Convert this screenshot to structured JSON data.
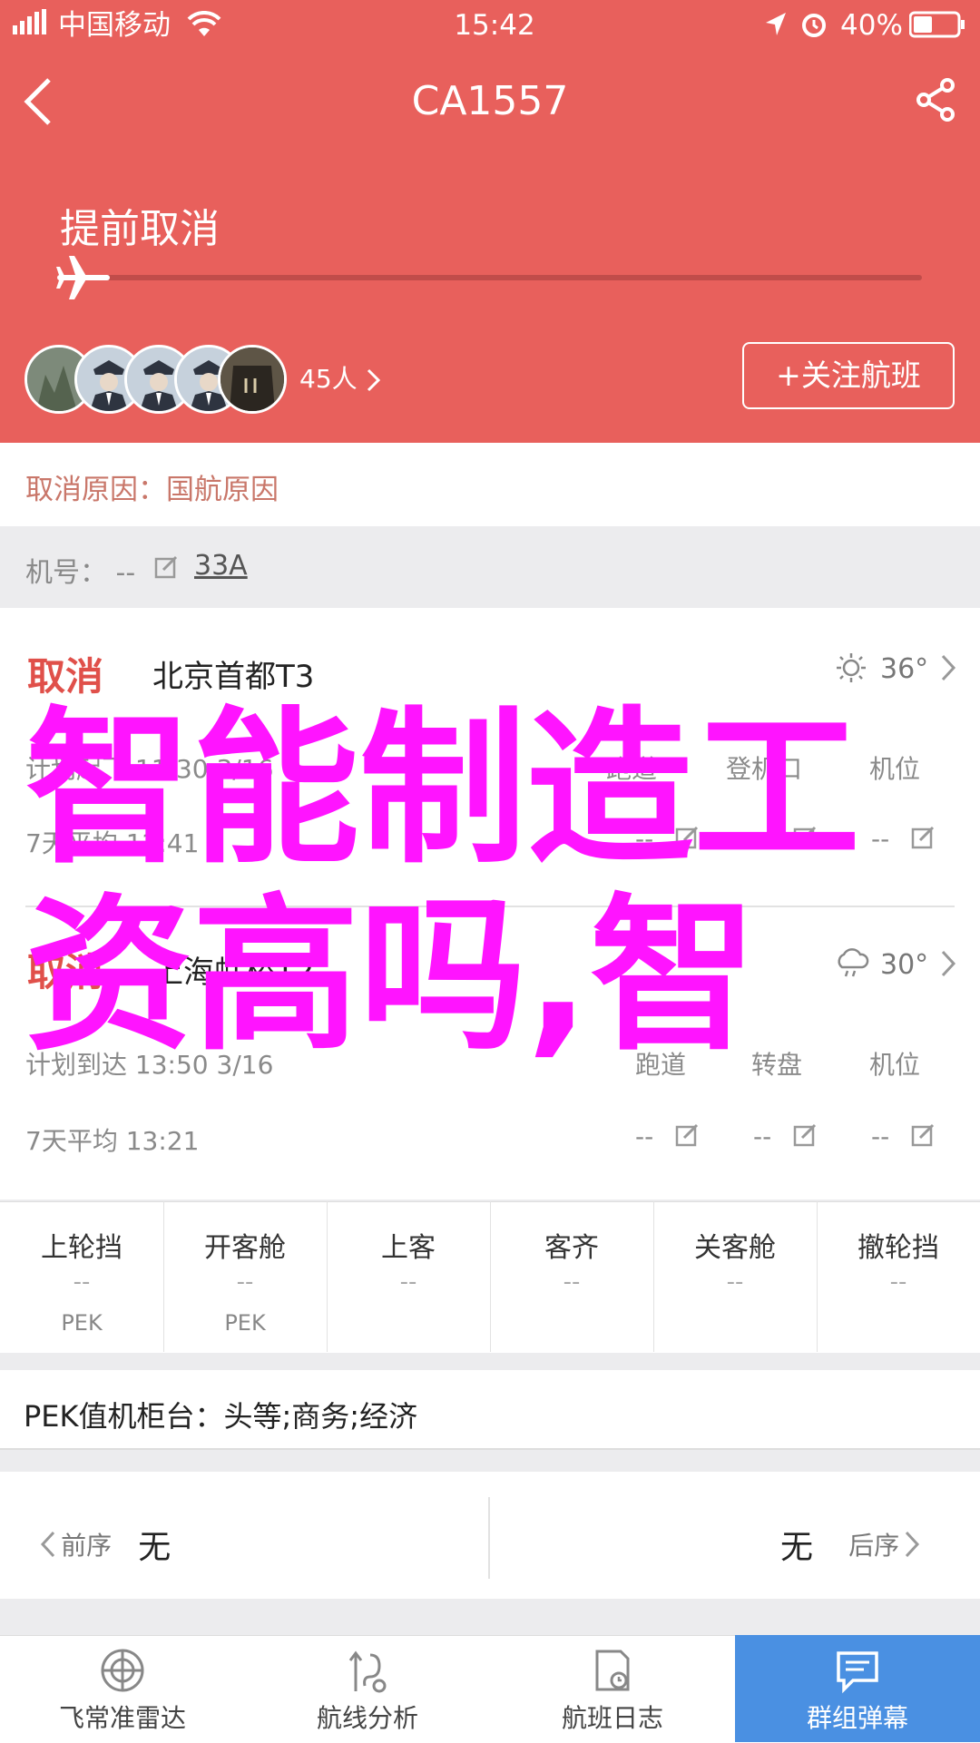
{
  "status_bar": {
    "carrier": "中国移动",
    "time": "15:42",
    "battery": "40%"
  },
  "header": {
    "title": "CA1557",
    "back_icon": "chevron-left-icon",
    "share_icon": "share-icon",
    "status_text": "提前取消",
    "progress_icon": "plane-icon",
    "followers_count": "45人",
    "follow_button": "+关注航班"
  },
  "cancel_reason": {
    "label": "取消原因：",
    "value": "国航原因"
  },
  "aircraft": {
    "label": "机号：",
    "value": "--",
    "model": "33A"
  },
  "departure": {
    "status": "取消",
    "airport": "北京首都T3",
    "weather_icon": "sun-icon",
    "temperature": "36°",
    "planned_label": "计划起飞",
    "planned_time": "11:30",
    "planned_date": "3/16",
    "col_runway": "跑道",
    "col_gate": "登机口",
    "col_stand": "机位",
    "avg_label": "7天平均",
    "avg_time": "12:41",
    "runway_value": "--",
    "gate_value": "--",
    "stand_value": "--"
  },
  "arrival": {
    "status": "取消",
    "airport": "上海虹桥T2",
    "weather_icon": "cloud-rain-icon",
    "temperature": "30°",
    "planned_label": "计划到达",
    "planned_time": "13:50",
    "planned_date": "3/16",
    "col_runway": "跑道",
    "col_carousel": "转盘",
    "col_stand": "机位",
    "avg_label": "7天平均",
    "avg_time": "13:21",
    "runway_value": "--",
    "carousel_value": "--",
    "stand_value": "--"
  },
  "status_steps": [
    {
      "label": "上轮挡",
      "value": "--",
      "code": "PEK"
    },
    {
      "label": "开客舱",
      "value": "--",
      "code": "PEK"
    },
    {
      "label": "上客",
      "value": "--",
      "code": ""
    },
    {
      "label": "客齐",
      "value": "--",
      "code": ""
    },
    {
      "label": "关客舱",
      "value": "--",
      "code": ""
    },
    {
      "label": "撤轮挡",
      "value": "--",
      "code": ""
    }
  ],
  "checkin": {
    "label": "PEK值机柜台：",
    "value": "头等;商务;经济"
  },
  "sequence": {
    "prev_label": "前序",
    "prev_value": "无",
    "next_value": "无",
    "next_label": "后序"
  },
  "tabbar": [
    {
      "label": "飞常准雷达",
      "icon": "radar-icon",
      "active": false
    },
    {
      "label": "航线分析",
      "icon": "route-icon",
      "active": false
    },
    {
      "label": "航班日志",
      "icon": "log-icon",
      "active": false
    },
    {
      "label": "群组弹幕",
      "icon": "chat-icon",
      "active": true
    }
  ],
  "watermark": {
    "line1": "智能制造工",
    "line2": "资高吗,智"
  },
  "colors": {
    "header_red": "#e8605c",
    "cancel_red": "#e0504a",
    "active_tab_blue": "#4a90e2",
    "watermark_magenta": "#ff14ff"
  }
}
